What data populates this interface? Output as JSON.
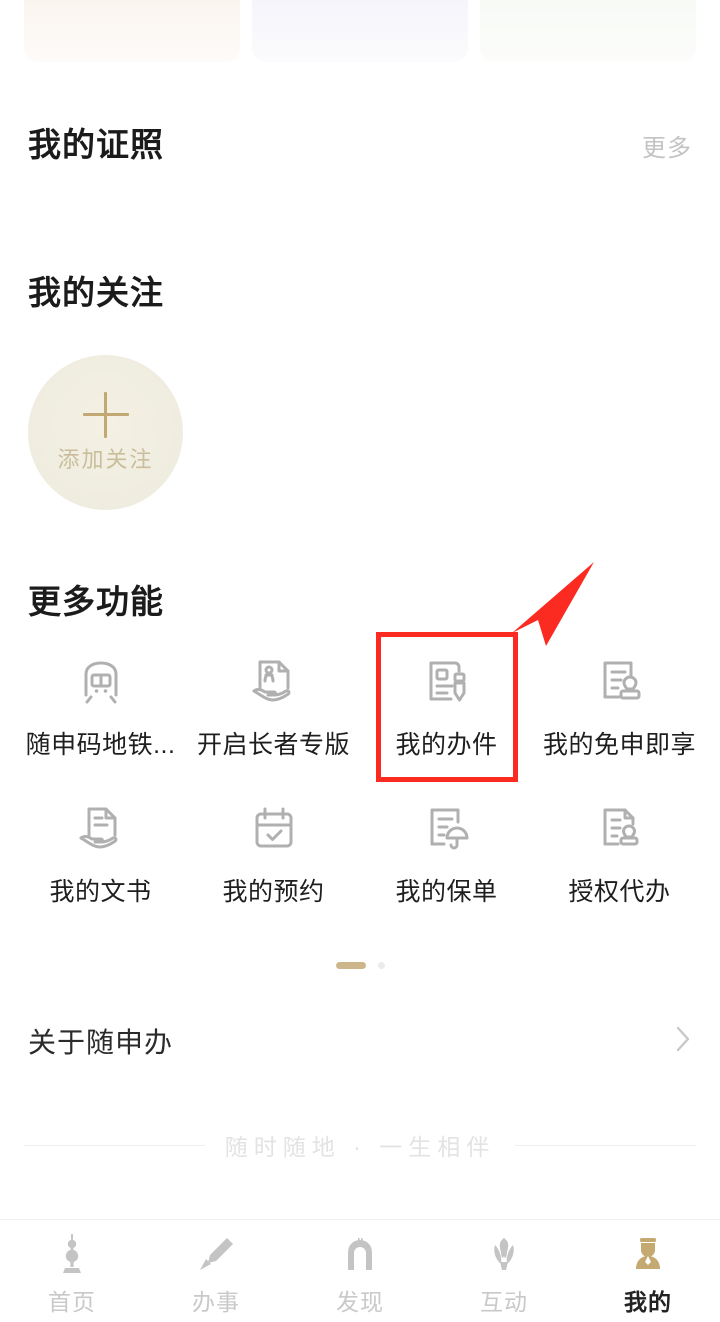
{
  "promo_cards": [
    {
      "name": "promo-card-cream",
      "color": "#fbf5ef"
    },
    {
      "name": "promo-card-lavender",
      "color": "#f6f5fb"
    },
    {
      "name": "promo-card-green",
      "color": "#f7faf6"
    }
  ],
  "sections": {
    "credentials": {
      "title": "我的证照",
      "more_label": "更多"
    },
    "follows": {
      "title": "我的关注"
    },
    "features": {
      "title": "更多功能"
    }
  },
  "add_follow": {
    "label": "添加关注",
    "icon": "plus-icon",
    "accent": "#c2a873"
  },
  "features": [
    {
      "label": "随申码地铁...",
      "icon": "metro-train-icon"
    },
    {
      "label": "开启长者专版",
      "icon": "elderly-document-hand-icon"
    },
    {
      "label": "我的办件",
      "icon": "document-pencil-icon",
      "highlighted": true
    },
    {
      "label": "我的免申即享",
      "icon": "document-stamp-icon"
    },
    {
      "label": "我的文书",
      "icon": "document-hand-icon"
    },
    {
      "label": "我的预约",
      "icon": "calendar-check-icon"
    },
    {
      "label": "我的保单",
      "icon": "document-umbrella-icon"
    },
    {
      "label": "授权代办",
      "icon": "document-seal-icon"
    }
  ],
  "annotation": {
    "color": "#fc2b22",
    "target_label": "我的办件",
    "shape": "red-rect-with-arrow"
  },
  "pager": {
    "total": 2,
    "active_index": 0
  },
  "about": {
    "label": "关于随申办",
    "icon": "chevron-right-icon"
  },
  "tagline": {
    "text": "随时随地 · 一生相伴"
  },
  "tabbar": {
    "active_index": 4,
    "active_color": "#c4a971",
    "items": [
      {
        "label": "首页",
        "icon": "pearl-tower-icon"
      },
      {
        "label": "办事",
        "icon": "fountain-pen-icon"
      },
      {
        "label": "发现",
        "icon": "arch-building-icon"
      },
      {
        "label": "互动",
        "icon": "magnolia-flower-icon"
      },
      {
        "label": "我的",
        "icon": "user-person-icon"
      }
    ]
  }
}
